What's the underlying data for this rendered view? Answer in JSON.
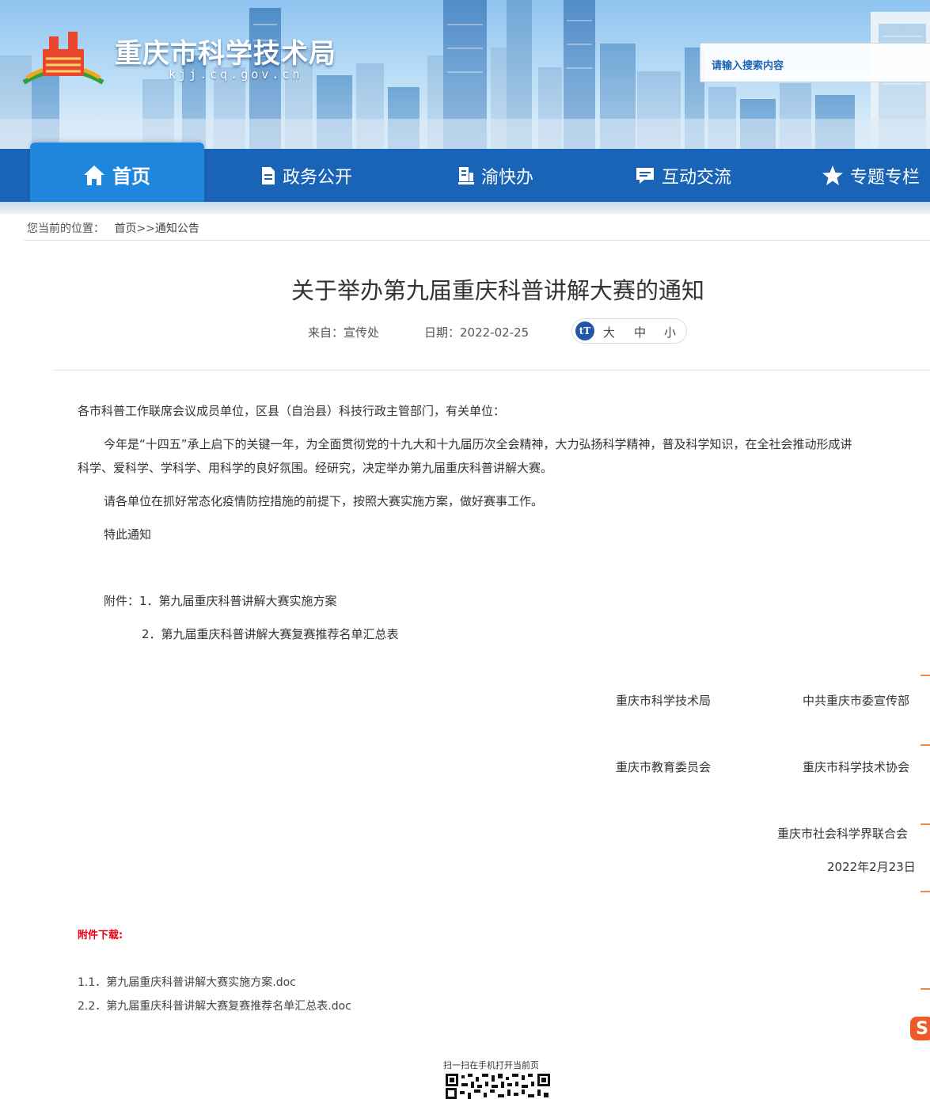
{
  "header": {
    "site_title": "重庆市科学技术局",
    "site_domain": "kjj.cq.gov.cn",
    "search_placeholder": "请输入搜索内容"
  },
  "nav": {
    "items": [
      {
        "label": "首页",
        "icon": "home-icon",
        "active": true
      },
      {
        "label": "政务公开",
        "icon": "document-icon"
      },
      {
        "label": "渝快办",
        "icon": "service-icon"
      },
      {
        "label": "互动交流",
        "icon": "chat-icon"
      },
      {
        "label": "专题专栏",
        "icon": "star-icon"
      }
    ]
  },
  "breadcrumb": {
    "prefix": "您当前的位置：",
    "home": "首页",
    "separator": ">>",
    "current": "通知公告"
  },
  "article": {
    "title": "关于举办第九届重庆科普讲解大赛的通知",
    "source_label": "来自：宣传处",
    "date_label": "日期：2022-02-25",
    "font_size": {
      "icon": "tT",
      "large": "大",
      "medium": "中",
      "small": "小"
    },
    "salutation": "各市科普工作联席会议成员单位，区县（自治县）科技行政主管部门，有关单位：",
    "para1_line1": "今年是“十四五”承上启下的关键一年，为全面贯彻党的十九大和十九届历次全会精神，大力弘扬科学精神，普及科学知识，在全社会推动形成讲",
    "para1_line2": "科学、爱科学、学科学、用科学的良好氛围。经研究，决定举办第九届重庆科普讲解大赛。",
    "para2": "请各单位在抓好常态化疫情防控措施的前提下，按照大赛实施方案，做好赛事工作。",
    "para3": "特此通知",
    "attachment1": "附件：1．第九届重庆科普讲解大赛实施方案",
    "attachment2": "2．第九届重庆科普讲解大赛复赛推荐名单汇总表",
    "signatures": {
      "org1": "重庆市科学技术局",
      "org2": "中共重庆市委宣传部",
      "org3": "重庆市教育委员会",
      "org4": "重庆市科学技术协会",
      "org5": "重庆市社会科学界联合会",
      "date": "2022年2月23日"
    }
  },
  "downloads": {
    "label": "附件下载:",
    "files": [
      "1.1．第九届重庆科普讲解大赛实施方案.doc",
      "2.2．第九届重庆科普讲解大赛复赛推荐名单汇总表.doc"
    ]
  },
  "footer": {
    "qr_label": "扫一扫在手机打开当前页"
  },
  "colors": {
    "nav_blue": "#1a64b8",
    "nav_active": "#1e86dc",
    "accent_red": "#e60012"
  }
}
